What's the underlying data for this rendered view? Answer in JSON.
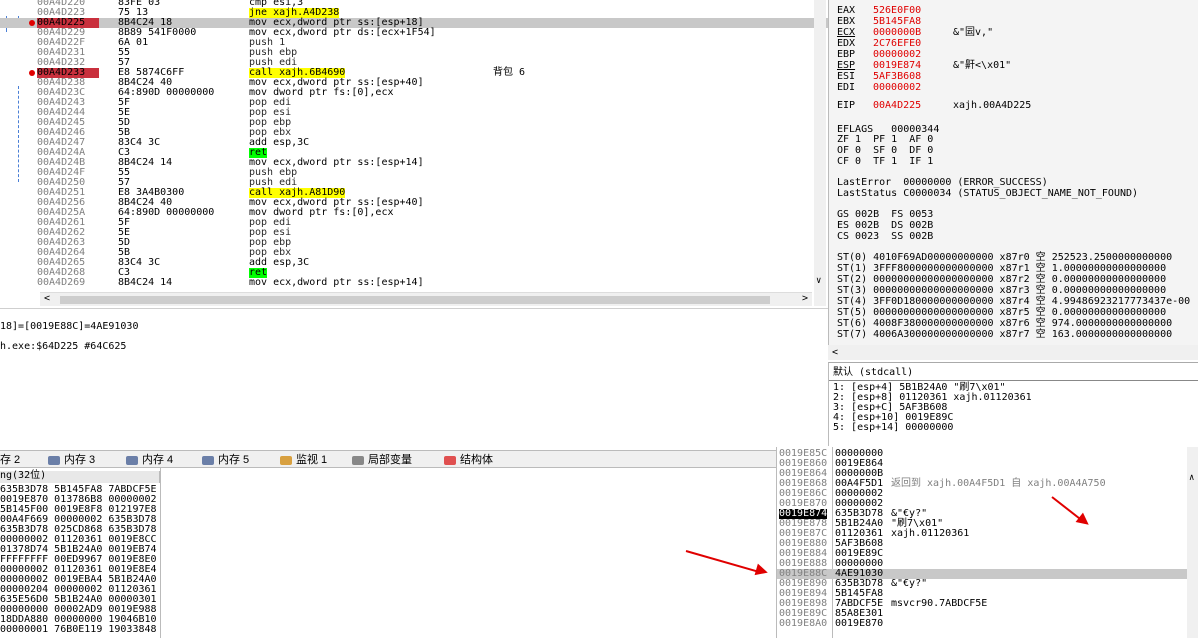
{
  "disasm": [
    {
      "addr": "00A4D220",
      "hex": "83FE 03",
      "ins": "cmp esi,3",
      "cmt": ""
    },
    {
      "addr": "00A4D223",
      "hex": "75 13",
      "ins": "jne xajh.A4D238",
      "cmt": ""
    },
    {
      "addr": "00A4D225",
      "hex": "8B4C24 18",
      "ins": "mov ecx,dword ptr ss:[esp+18]",
      "cmt": ""
    },
    {
      "addr": "00A4D229",
      "hex": "8B89 541F0000",
      "ins": "mov ecx,dword ptr ds:[ecx+1F54]",
      "cmt": ""
    },
    {
      "addr": "00A4D22F",
      "hex": "6A 01",
      "ins": "push 1",
      "cmt": ""
    },
    {
      "addr": "00A4D231",
      "hex": "55",
      "ins": "push ebp",
      "cmt": ""
    },
    {
      "addr": "00A4D232",
      "hex": "57",
      "ins": "push edi",
      "cmt": ""
    },
    {
      "addr": "00A4D233",
      "hex": "E8 5874C6FF",
      "ins": "call xajh.6B4690",
      "cmt": "背包 6"
    },
    {
      "addr": "00A4D238",
      "hex": "8B4C24 40",
      "ins": "mov ecx,dword ptr ss:[esp+40]",
      "cmt": ""
    },
    {
      "addr": "00A4D23C",
      "hex": "64:890D 00000000",
      "ins": "mov dword ptr fs:[0],ecx",
      "cmt": ""
    },
    {
      "addr": "00A4D243",
      "hex": "5F",
      "ins": "pop edi",
      "cmt": ""
    },
    {
      "addr": "00A4D244",
      "hex": "5E",
      "ins": "pop esi",
      "cmt": ""
    },
    {
      "addr": "00A4D245",
      "hex": "5D",
      "ins": "pop ebp",
      "cmt": ""
    },
    {
      "addr": "00A4D246",
      "hex": "5B",
      "ins": "pop ebx",
      "cmt": ""
    },
    {
      "addr": "00A4D247",
      "hex": "83C4 3C",
      "ins": "add esp,3C",
      "cmt": ""
    },
    {
      "addr": "00A4D24A",
      "hex": "C3",
      "ins": "ret",
      "cmt": ""
    },
    {
      "addr": "00A4D24B",
      "hex": "8B4C24 14",
      "ins": "mov ecx,dword ptr ss:[esp+14]",
      "cmt": ""
    },
    {
      "addr": "00A4D24F",
      "hex": "55",
      "ins": "push ebp",
      "cmt": ""
    },
    {
      "addr": "00A4D250",
      "hex": "57",
      "ins": "push edi",
      "cmt": ""
    },
    {
      "addr": "00A4D251",
      "hex": "E8 3A4B0300",
      "ins": "call xajh.A81D90",
      "cmt": ""
    },
    {
      "addr": "00A4D256",
      "hex": "8B4C24 40",
      "ins": "mov ecx,dword ptr ss:[esp+40]",
      "cmt": ""
    },
    {
      "addr": "00A4D25A",
      "hex": "64:890D 00000000",
      "ins": "mov dword ptr fs:[0],ecx",
      "cmt": ""
    },
    {
      "addr": "00A4D261",
      "hex": "5F",
      "ins": "pop edi",
      "cmt": ""
    },
    {
      "addr": "00A4D262",
      "hex": "5E",
      "ins": "pop esi",
      "cmt": ""
    },
    {
      "addr": "00A4D263",
      "hex": "5D",
      "ins": "pop ebp",
      "cmt": ""
    },
    {
      "addr": "00A4D264",
      "hex": "5B",
      "ins": "pop ebx",
      "cmt": ""
    },
    {
      "addr": "00A4D265",
      "hex": "83C4 3C",
      "ins": "add esp,3C",
      "cmt": ""
    },
    {
      "addr": "00A4D268",
      "hex": "C3",
      "ins": "ret",
      "cmt": ""
    },
    {
      "addr": "00A4D269",
      "hex": "8B4C24 14",
      "ins": "mov ecx,dword ptr ss:[esp+14]",
      "cmt": ""
    }
  ],
  "info": {
    "line1": "18]=[0019E88C]=4AE91030",
    "line2": "h.exe:$64D225 #64C625"
  },
  "regs": {
    "gp": [
      {
        "n": "EAX",
        "v": "526E0F00",
        "c": ""
      },
      {
        "n": "EBX",
        "v": "5B145FA8",
        "c": ""
      },
      {
        "n": "ECX",
        "v": "0000000B",
        "c": "&\"囩v,\""
      },
      {
        "n": "EDX",
        "v": "2C76EFE0",
        "c": ""
      },
      {
        "n": "EBP",
        "v": "00000002",
        "c": ""
      },
      {
        "n": "ESP",
        "v": "0019E874",
        "c": "&\"鼾<\\x01\""
      },
      {
        "n": "ESI",
        "v": "5AF3B608",
        "c": ""
      },
      {
        "n": "EDI",
        "v": "00000002",
        "c": ""
      }
    ],
    "eip": {
      "n": "EIP",
      "v": "00A4D225",
      "c": "xajh.00A4D225"
    },
    "eflags": "EFLAGS   00000344",
    "flags": [
      "ZF 1  PF 1  AF 0",
      "OF 0  SF 0  DF 0",
      "CF 0  TF 1  IF 1"
    ],
    "lasterror": "LastError  00000000 (ERROR_SUCCESS)",
    "laststatus": "LastStatus C0000034 (STATUS_OBJECT_NAME_NOT_FOUND)",
    "segs": [
      "GS 002B  FS 0053",
      "ES 002B  DS 002B",
      "CS 0023  SS 002B"
    ],
    "st": [
      "ST(0) 4010F69AD00000000000 x87r0 空 252523.2500000000000",
      "ST(1) 3FFF8000000000000000 x87r1 空 1.00000000000000000",
      "ST(2) 00000000000000000000 x87r2 空 0.00000000000000000",
      "ST(3) 00000000000000000000 x87r3 空 0.00000000000000000",
      "ST(4) 3FF0D180000000000000 x87r4 空 4.99486923217773437e-00",
      "ST(5) 00000000000000000000 x87r5 空 0.00000000000000000",
      "ST(6) 4008F380000000000000 x87r6 空 974.0000000000000000",
      "ST(7) 4006A300000000000000 x87r7 空 163.0000000000000000"
    ]
  },
  "callconv": {
    "header": "默认 (stdcall)",
    "rows": [
      "1: [esp+4] 5B1B24A0 \"刷7\\x01\"",
      "2: [esp+8] 01120361 xajh.01120361",
      "3: [esp+C] 5AF3B608",
      "4: [esp+10] 0019E89C",
      "5: [esp+14] 00000000"
    ]
  },
  "tabs": [
    {
      "label": "存 2",
      "icon": ""
    },
    {
      "label": "内存 3",
      "icon": "memory-icon"
    },
    {
      "label": "内存 4",
      "icon": "memory-icon"
    },
    {
      "label": "内存 5",
      "icon": "memory-icon"
    },
    {
      "label": "监视 1",
      "icon": "watch-icon"
    },
    {
      "label": "局部变量",
      "icon": "locals-icon"
    },
    {
      "label": "结构体",
      "icon": "struct-icon"
    }
  ],
  "dump": {
    "header": "ng(32位)",
    "rows": [
      "635B3D78 5B145FA8 7ABDCF5E",
      "0019E870 013786B8 00000002",
      "5B145F00 0019E8F8 012197E8",
      "00A4F669 00000002 635B3D78",
      "635B3D78 025CD868 635B3D78",
      "00000002 01120361 0019E8CC",
      "01378D74 5B1B24A0 0019EB74",
      "FFFFFFFF 00ED9967 0019E8E0",
      "00000002 01120361 0019E8E4",
      "00000002 0019EBA4 5B1B24A0",
      "00000204 00000002 01120361",
      "635E56D0 5B1B24A0 00000301",
      "00000000 00002AD9 0019E988",
      "18DDA880 00000000 19046B10",
      "00000001 76B0E119 19033848"
    ]
  },
  "stack": [
    {
      "a": "0019E85C",
      "v": "00000000",
      "c": ""
    },
    {
      "a": "0019E860",
      "v": "0019E864",
      "c": ""
    },
    {
      "a": "0019E864",
      "v": "0000000B",
      "c": ""
    },
    {
      "a": "0019E868",
      "v": "00A4F5D1",
      "c": "返回到 xajh.00A4F5D1 自 xajh.00A4A750"
    },
    {
      "a": "0019E86C",
      "v": "00000002",
      "c": ""
    },
    {
      "a": "0019E870",
      "v": "00000002",
      "c": ""
    },
    {
      "a": "0019E874",
      "v": "635B3D78",
      "c": "&\"€y?\""
    },
    {
      "a": "0019E878",
      "v": "5B1B24A0",
      "c": "\"刷7\\x01\""
    },
    {
      "a": "0019E87C",
      "v": "01120361",
      "c": "xajh.01120361"
    },
    {
      "a": "0019E880",
      "v": "5AF3B608",
      "c": ""
    },
    {
      "a": "0019E884",
      "v": "0019E89C",
      "c": ""
    },
    {
      "a": "0019E888",
      "v": "00000000",
      "c": ""
    },
    {
      "a": "0019E88C",
      "v": "4AE91030",
      "c": ""
    },
    {
      "a": "0019E890",
      "v": "635B3D78",
      "c": "&\"€y?\""
    },
    {
      "a": "0019E894",
      "v": "5B145FA8",
      "c": ""
    },
    {
      "a": "0019E898",
      "v": "7ABDCF5E",
      "c": "msvcr90.7ABDCF5E"
    },
    {
      "a": "0019E89C",
      "v": "85A8E301",
      "c": ""
    },
    {
      "a": "0019E8A0",
      "v": "0019E870",
      "c": ""
    }
  ]
}
